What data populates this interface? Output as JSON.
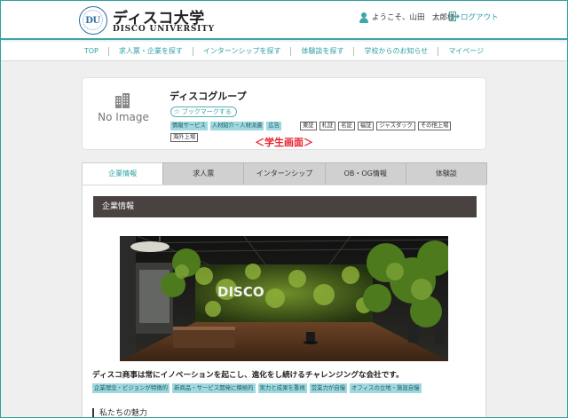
{
  "header": {
    "logo_emblem": "DU",
    "logo_ja": "ディスコ大学",
    "logo_en": "DISCO UNIVERSITY",
    "welcome": "ようこそ、山田　太郎様",
    "logout": "ログアウト",
    "accent": "#3aa7a8"
  },
  "nav": {
    "items": [
      "TOP",
      "求人票・企業を探す",
      "インターンシップを探す",
      "体験談を探す",
      "学校からのお知らせ",
      "マイページ"
    ]
  },
  "company": {
    "image_placeholder": "No Image",
    "name": "ディスコグループ",
    "bookmark": "ブックマークする",
    "industry_tags": [
      "情報サービス",
      "人材紹介・人材派遣",
      "広告"
    ],
    "market_tags": [
      "東証",
      "札証",
      "名証",
      "福証",
      "ジャスダック",
      "その他上場",
      "海外上場"
    ]
  },
  "student_label": "＜学生画面＞",
  "tabs": [
    "企業情報",
    "求人票",
    "インターンシップ",
    "OB・OG情報",
    "体験談"
  ],
  "content": {
    "section_title": "企業情報",
    "photo_sign": "DISCO",
    "headline": "ディスコ商事は常にイノベーションを起こし、進化をし続けるチャレンジングな会社です。",
    "feature_tags": [
      "企業理念・ビジョンが特徴的",
      "新商品・サービス開発に積極的",
      "実力と成果を重視",
      "営業力が自慢",
      "オフィスの立地・施設自慢"
    ],
    "subheading": "私たちの魅力"
  }
}
